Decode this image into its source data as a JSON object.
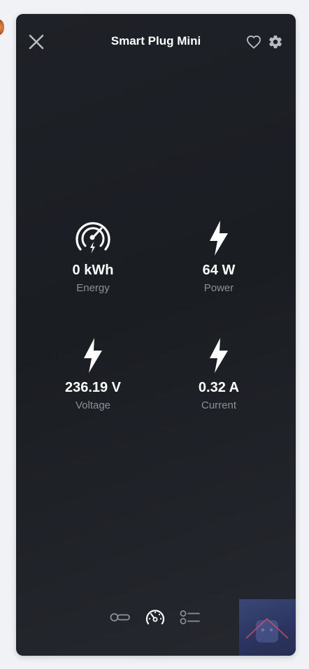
{
  "header": {
    "title": "Smart Plug Mini"
  },
  "icons": {
    "close": "close-icon",
    "favorite": "heart-outline-icon",
    "settings": "gear-icon",
    "energy": "gauge-bolt-icon",
    "power": "lightning-bolt-icon",
    "voltage": "lightning-bolt-icon",
    "current": "lightning-bolt-icon",
    "tab_controls": "toggle-switch-icon",
    "tab_sensors": "speedometer-icon",
    "tab_list": "checklist-icon"
  },
  "sensors": [
    {
      "value": "0 kWh",
      "label": "Energy"
    },
    {
      "value": "64 W",
      "label": "Power"
    },
    {
      "value": "236.19 V",
      "label": "Voltage"
    },
    {
      "value": "0.32 A",
      "label": "Current"
    }
  ],
  "colors": {
    "panel_bg": "#1e2127",
    "text_primary": "#ffffff",
    "text_secondary": "#8d9097",
    "icon_muted": "#8d9097",
    "watermark_bg": "#2c3562",
    "watermark_line": "#e0506a"
  }
}
